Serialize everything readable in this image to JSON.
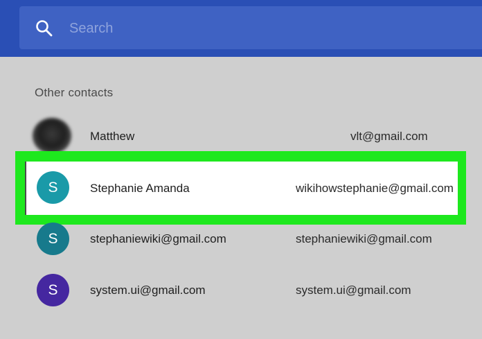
{
  "search": {
    "placeholder": "Search"
  },
  "section": {
    "title": "Other contacts"
  },
  "contacts": [
    {
      "initial": "",
      "name": "Matthew",
      "email": "vlt@gmail.com",
      "avatar_color": "#2a2a2a"
    },
    {
      "initial": "S",
      "name": "Stephanie Amanda",
      "email": "wikihowstephanie@gmail.com",
      "avatar_color": "#1a9aa8"
    },
    {
      "initial": "S",
      "name": "stephaniewiki@gmail.com",
      "email": "stephaniewiki@gmail.com",
      "avatar_color": "#177a8c"
    },
    {
      "initial": "S",
      "name": "system.ui@gmail.com",
      "email": "system.ui@gmail.com",
      "avatar_color": "#4527a0"
    }
  ],
  "colors": {
    "header": "#2a4fb5",
    "search_box": "#3f62c3",
    "highlight": "#1ee81e",
    "background": "#cfcfcf"
  }
}
